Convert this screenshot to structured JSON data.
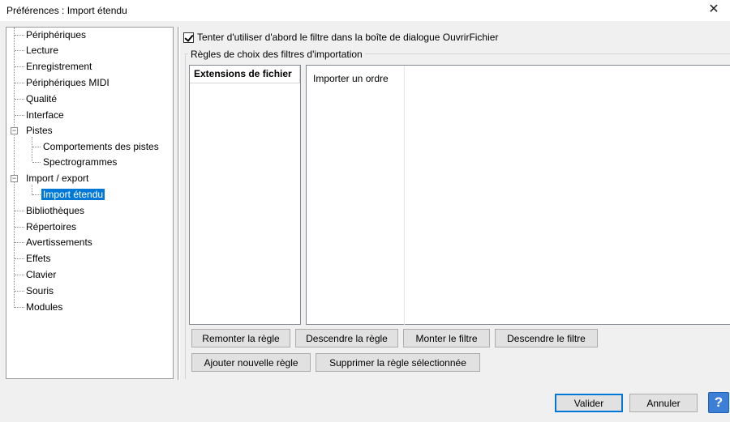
{
  "window": {
    "title": "Préférences : Import étendu",
    "close_glyph": "✕"
  },
  "tree": {
    "items": [
      {
        "label": "Périphériques"
      },
      {
        "label": "Lecture"
      },
      {
        "label": "Enregistrement"
      },
      {
        "label": "Périphériques MIDI"
      },
      {
        "label": "Qualité"
      },
      {
        "label": "Interface"
      },
      {
        "label": "Pistes"
      },
      {
        "label": "Comportements des pistes"
      },
      {
        "label": "Spectrogrammes"
      },
      {
        "label": "Import / export"
      },
      {
        "label": "Import étendu"
      },
      {
        "label": "Bibliothèques"
      },
      {
        "label": "Répertoires"
      },
      {
        "label": "Avertissements"
      },
      {
        "label": "Effets"
      },
      {
        "label": "Clavier"
      },
      {
        "label": "Souris"
      },
      {
        "label": "Modules"
      }
    ],
    "selected": "Import étendu",
    "expander_minus": "−"
  },
  "options": {
    "use_filter_checkbox_label": "Tenter d'utiliser d'abord le filtre dans la boîte de dialogue OuvrirFichier",
    "use_filter_checked": true
  },
  "rules_group": {
    "label": "Règles de choix des filtres d'importation",
    "extensions_header": "Extensions de fichier",
    "order_header": "Importer un ordre"
  },
  "buttons": {
    "move_rule_up": "Remonter la règle",
    "move_rule_down": "Descendre la règle",
    "move_filter_up": "Monter le filtre",
    "move_filter_down": "Descendre le filtre",
    "add_rule": "Ajouter nouvelle règle",
    "delete_rule": "Supprimer la règle sélectionnée",
    "ok": "Valider",
    "cancel": "Annuler",
    "help": "?"
  },
  "colors": {
    "selection": "#0078d7",
    "help_button": "#3b7fd6"
  }
}
